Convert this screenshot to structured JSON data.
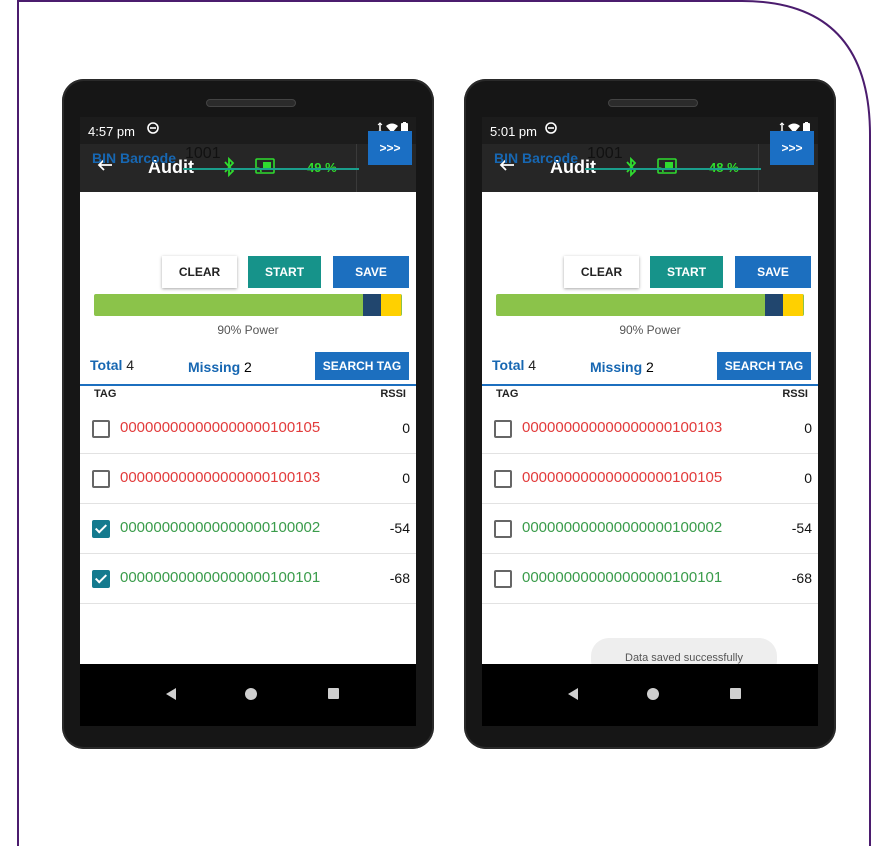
{
  "colors": {
    "frame_border": "#4b1c6e",
    "accent_blue": "#1c6fbf",
    "accent_teal": "#16938a",
    "missing_red": "#e23b3b",
    "found_green": "#3a9c4b",
    "battery_green": "#2fdc2f"
  },
  "phones": [
    {
      "status": {
        "time": "4:57 pm"
      },
      "toolbar": {
        "title": "Audit",
        "battery": "49 %"
      },
      "bin": {
        "label": "BIN Barcode",
        "value": "1001",
        "go_label": ">>>"
      },
      "buttons": {
        "clear": "CLEAR",
        "start": "START",
        "save": "SAVE"
      },
      "power": {
        "label": "90% Power",
        "level": 0.9
      },
      "totals": {
        "total_label": "Total",
        "total_value": "4",
        "missing_label": "Missing",
        "missing_value": "2"
      },
      "search_label": "SEARCH TAG",
      "table": {
        "col_tag": "TAG",
        "col_rssi": "RSSI"
      },
      "rows": [
        {
          "tag": "000000000000000000100105",
          "rssi": "0",
          "checked": false,
          "status": "missing"
        },
        {
          "tag": "000000000000000000100103",
          "rssi": "0",
          "checked": false,
          "status": "missing"
        },
        {
          "tag": "000000000000000000100002",
          "rssi": "-54",
          "checked": true,
          "status": "found"
        },
        {
          "tag": "000000000000000000100101",
          "rssi": "-68",
          "checked": true,
          "status": "found"
        }
      ],
      "toast": ""
    },
    {
      "status": {
        "time": "5:01 pm"
      },
      "toolbar": {
        "title": "Audit",
        "battery": "48 %"
      },
      "bin": {
        "label": "BIN Barcode",
        "value": "1001",
        "go_label": ">>>"
      },
      "buttons": {
        "clear": "CLEAR",
        "start": "START",
        "save": "SAVE"
      },
      "power": {
        "label": "90% Power",
        "level": 0.9
      },
      "totals": {
        "total_label": "Total",
        "total_value": "4",
        "missing_label": "Missing",
        "missing_value": "2"
      },
      "search_label": "SEARCH TAG",
      "table": {
        "col_tag": "TAG",
        "col_rssi": "RSSI"
      },
      "rows": [
        {
          "tag": "000000000000000000100103",
          "rssi": "0",
          "checked": false,
          "status": "missing"
        },
        {
          "tag": "000000000000000000100105",
          "rssi": "0",
          "checked": false,
          "status": "missing"
        },
        {
          "tag": "000000000000000000100002",
          "rssi": "-54",
          "checked": false,
          "status": "found"
        },
        {
          "tag": "000000000000000000100101",
          "rssi": "-68",
          "checked": false,
          "status": "found"
        }
      ],
      "toast": "Data saved successfully"
    }
  ]
}
